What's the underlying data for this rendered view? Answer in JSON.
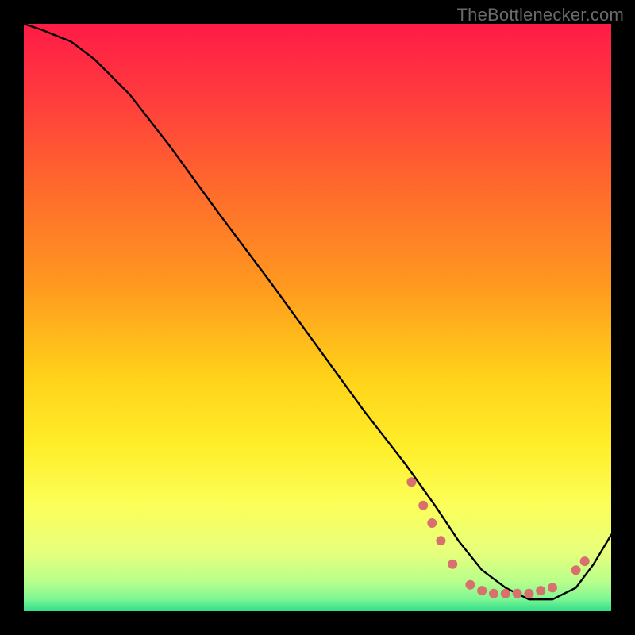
{
  "watermark": "TheBottlenecker.com",
  "chart_data": {
    "type": "line",
    "title": "",
    "xlabel": "",
    "ylabel": "",
    "xlim": [
      0,
      100
    ],
    "ylim": [
      0,
      100
    ],
    "grid": false,
    "legend": false,
    "background_gradient": {
      "stops": [
        {
          "pos": 0.0,
          "color": "#ff1b47"
        },
        {
          "pos": 0.12,
          "color": "#ff3a3e"
        },
        {
          "pos": 0.28,
          "color": "#ff6a2c"
        },
        {
          "pos": 0.45,
          "color": "#ff9a1f"
        },
        {
          "pos": 0.6,
          "color": "#ffd219"
        },
        {
          "pos": 0.72,
          "color": "#ffee2a"
        },
        {
          "pos": 0.82,
          "color": "#fbff59"
        },
        {
          "pos": 0.9,
          "color": "#e7ff7d"
        },
        {
          "pos": 0.95,
          "color": "#b8ff8b"
        },
        {
          "pos": 0.98,
          "color": "#7cf693"
        },
        {
          "pos": 1.0,
          "color": "#30dd8a"
        }
      ]
    },
    "series": [
      {
        "name": "curve",
        "color": "#000000",
        "stroke_width": 2.4,
        "x": [
          0,
          3,
          8,
          12,
          18,
          25,
          33,
          42,
          50,
          58,
          65,
          70,
          74,
          78,
          82,
          86,
          90,
          94,
          97,
          100
        ],
        "y": [
          100,
          99,
          97,
          94,
          88,
          79,
          68,
          56,
          45,
          34,
          25,
          18,
          12,
          7,
          4,
          2,
          2,
          4,
          8,
          13
        ]
      }
    ],
    "markers": {
      "name": "highlight-dots",
      "color": "#d8706e",
      "radius": 6,
      "points": [
        {
          "x": 66,
          "y": 22
        },
        {
          "x": 68,
          "y": 18
        },
        {
          "x": 69.5,
          "y": 15
        },
        {
          "x": 71,
          "y": 12
        },
        {
          "x": 73,
          "y": 8
        },
        {
          "x": 76,
          "y": 4.5
        },
        {
          "x": 78,
          "y": 3.5
        },
        {
          "x": 80,
          "y": 3
        },
        {
          "x": 82,
          "y": 3
        },
        {
          "x": 84,
          "y": 3
        },
        {
          "x": 86,
          "y": 3
        },
        {
          "x": 88,
          "y": 3.5
        },
        {
          "x": 90,
          "y": 4
        },
        {
          "x": 94,
          "y": 7
        },
        {
          "x": 95.5,
          "y": 8.5
        }
      ]
    }
  }
}
